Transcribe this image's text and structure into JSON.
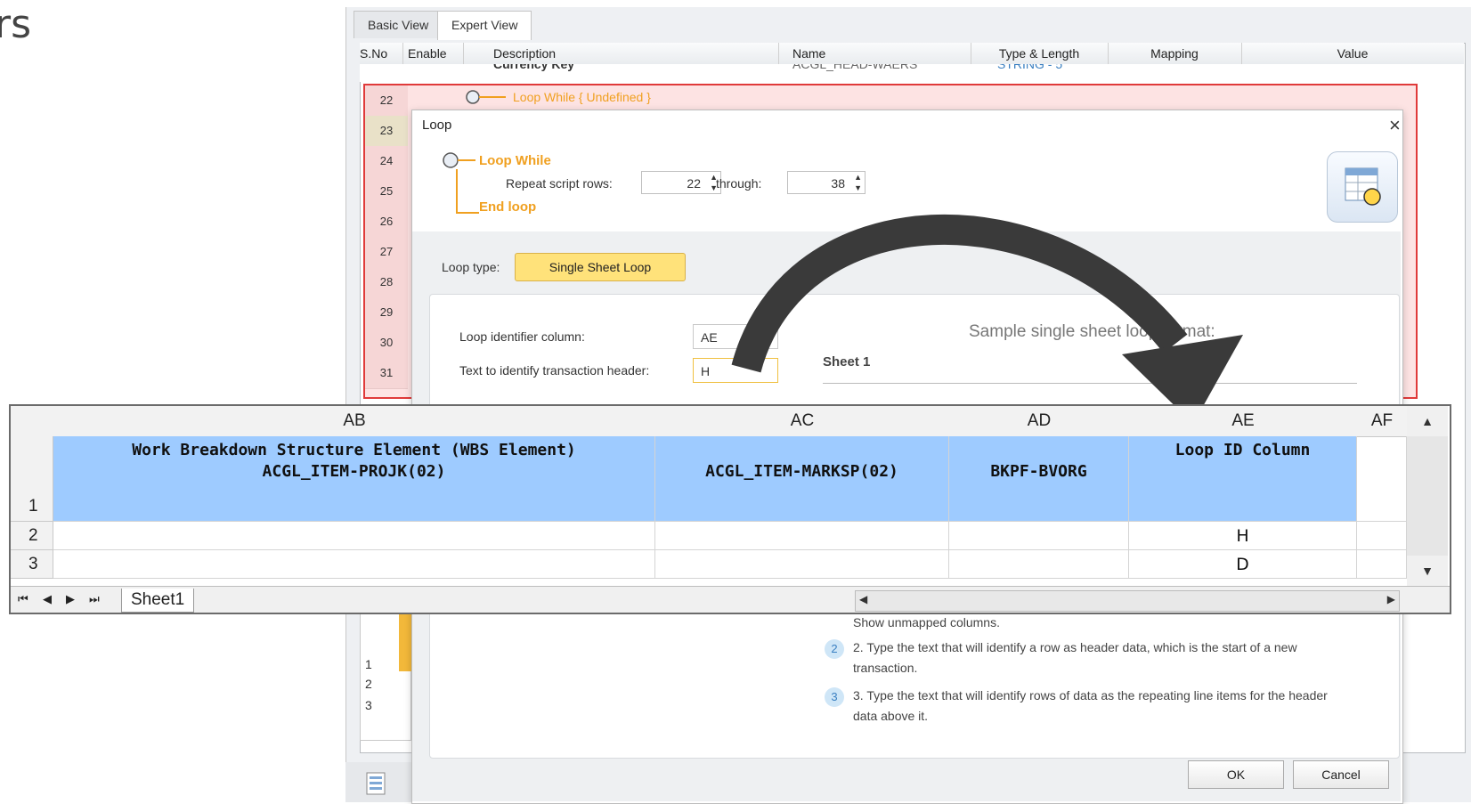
{
  "left_title": "rs",
  "window": {
    "tabs": [
      {
        "label": "Basic View",
        "active": false
      },
      {
        "label": "Expert View",
        "active": true
      }
    ],
    "grid_headers": [
      "S.No",
      "Enable",
      "Description",
      "Name",
      "Type & Length",
      "Mapping",
      "Value"
    ],
    "peek_row": {
      "description": "Currency Key",
      "name": "ACGL_HEAD-WAERS",
      "type": "STRING - 5"
    },
    "row_numbers": [
      "22",
      "23",
      "24",
      "25",
      "26",
      "27",
      "28",
      "29",
      "30",
      "31"
    ],
    "loop_row_label": "Loop While { Undefined }"
  },
  "dialog": {
    "title": "Loop",
    "close_glyph": "×",
    "loop_while_label": "Loop While",
    "repeat_label": "Repeat script rows:",
    "from_row": "22",
    "through_label": "through:",
    "to_row": "38",
    "end_loop_label": "End loop",
    "loop_type_label": "Loop type:",
    "loop_type_value": "Single Sheet Loop",
    "loop_id_label": "Loop identifier column:",
    "loop_id_value": "AE",
    "txn_label": "Text to identify transaction header:",
    "txn_value": "H",
    "sample_label": "Sample single sheet loop format:",
    "sheet_label": "Sheet 1",
    "instructions": [
      {
        "num": "",
        "text": "Show unmapped columns."
      },
      {
        "num": "2",
        "text": "2. Type the text that will identify a row as header data, which is the start of a new transaction."
      },
      {
        "num": "3",
        "text": "3. Type the text that will identify rows of data as the repeating line items for the header data above it."
      }
    ],
    "ok_label": "OK",
    "cancel_label": "Cancel"
  },
  "background_sheet": {
    "rows": [
      "1",
      "2",
      "3"
    ]
  },
  "spreadsheet": {
    "columns": [
      "AB",
      "AC",
      "AD",
      "AE",
      "AF"
    ],
    "rows": [
      "1",
      "2",
      "3"
    ],
    "header_cells": {
      "AB": [
        "Work Breakdown Structure Element (WBS Element)",
        "ACGL_ITEM-PROJK(02)"
      ],
      "AC": [
        "ACGL_ITEM-MARKSP(02)"
      ],
      "AD": [
        "BKPF-BVORG"
      ],
      "AE": [
        "Loop ID Column"
      ]
    },
    "row2_AE": "H",
    "row3_AE": "D",
    "sheet_tab": "Sheet1",
    "nav_glyphs": [
      "⏮",
      "◀",
      "▶",
      "⏭"
    ]
  },
  "colors": {
    "highlight": "#9ecbff",
    "loop_accent": "#f0a020",
    "loop_border": "#e03a3a",
    "loop_type_bg": "#ffe27a"
  }
}
